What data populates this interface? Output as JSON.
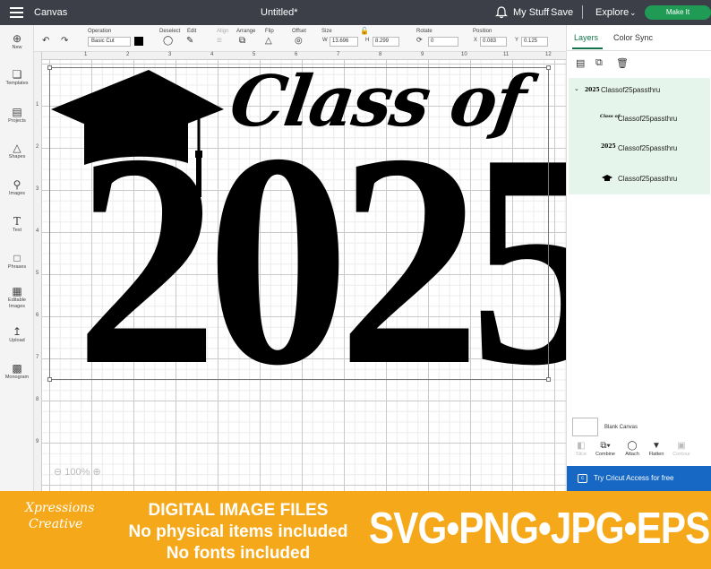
{
  "topbar": {
    "app_title": "Canvas",
    "document_title": "Untitled*",
    "my_stuff": "My Stuff",
    "save": "Save",
    "explore": "Explore",
    "make_it": "Make It"
  },
  "toolbar": {
    "operation_label": "Operation",
    "operation_value": "Basic Cut",
    "deselect_label": "Deselect",
    "edit_label": "Edit",
    "align_label": "Align",
    "arrange_label": "Arrange",
    "flip_label": "Flip",
    "offset_label": "Offset",
    "size_label": "Size",
    "width_prefix": "W",
    "width_value": "13.696",
    "height_prefix": "H",
    "height_value": "8.299",
    "rotate_label": "Rotate",
    "rotate_value": "0",
    "position_label": "Position",
    "x_prefix": "X",
    "x_value": "0.083",
    "y_prefix": "Y",
    "y_value": "0.125"
  },
  "sidebar": {
    "items": [
      {
        "label": "New",
        "icon": "plus-icon"
      },
      {
        "label": "Templates",
        "icon": "shirt-icon"
      },
      {
        "label": "Projects",
        "icon": "clipboard-icon"
      },
      {
        "label": "Shapes",
        "icon": "shapes-icon"
      },
      {
        "label": "Images",
        "icon": "bulb-icon"
      },
      {
        "label": "Text",
        "icon": "text-icon"
      },
      {
        "label": "Phrases",
        "icon": "speech-icon"
      },
      {
        "label": "Editable Images",
        "icon": "editable-icon"
      },
      {
        "label": "Upload",
        "icon": "upload-icon"
      },
      {
        "label": "Monogram",
        "icon": "monogram-icon"
      }
    ]
  },
  "ruler": {
    "top": [
      "1",
      "2",
      "3",
      "4",
      "5",
      "6",
      "7",
      "8",
      "9",
      "10",
      "11",
      "12"
    ],
    "left": [
      "1",
      "2",
      "3",
      "4",
      "5",
      "6",
      "7",
      "8",
      "9"
    ]
  },
  "canvas": {
    "design_line1": "Class of",
    "design_line2": "2025",
    "zoom": "100%"
  },
  "panel": {
    "tab_layers": "Layers",
    "tab_color_sync": "Color Sync",
    "group_name": "Classof25passthru",
    "layers": [
      {
        "thumb": "Class of",
        "name": "Classof25passthru"
      },
      {
        "thumb": "2025",
        "name": "Classof25passthru"
      },
      {
        "thumb": "cap",
        "name": "Classof25passthru"
      }
    ],
    "group_thumb": "2025",
    "blank_canvas": "Blank Canvas",
    "tools": [
      "Slice",
      "Combine",
      "Attach",
      "Flatten",
      "Contour"
    ],
    "cricut_access": "Try Cricut Access for free"
  },
  "promo": {
    "brand_line1": "Xpressions",
    "brand_line2": "Creative",
    "line1": "DIGITAL IMAGE FILES",
    "line2": "No physical items included",
    "line3": "No fonts included",
    "formats": "SVG•PNG•JPG•EPS"
  },
  "colors": {
    "topbar": "#3c3f47",
    "make_it": "#1f9b55",
    "layers_highlight": "#e5f5ec",
    "cricut_banner": "#1768c4",
    "promo_orange": "#f5a91a"
  }
}
